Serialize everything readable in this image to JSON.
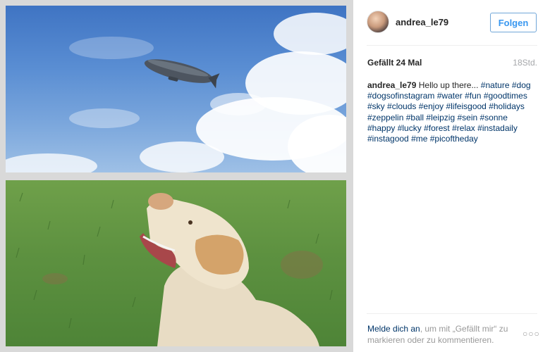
{
  "post": {
    "username": "andrea_le79",
    "follow_label": "Folgen",
    "likes": "Gefällt 24 Mal",
    "time": "18Std.",
    "caption_user": "andrea_le79",
    "caption_text": "Hello up there...",
    "hashtags": [
      "#nature",
      "#dog",
      "#dogsofinstagram",
      "#water",
      "#fun",
      "#goodtimes",
      "#sky",
      "#clouds",
      "#enjoy",
      "#lifeisgood",
      "#holidays",
      "#zeppelin",
      "#ball",
      "#leipzig",
      "#sein",
      "#sonne",
      "#happy",
      "#lucky",
      "#forest",
      "#relax",
      "#instadaily",
      "#instagood",
      "#me",
      "#picoftheday"
    ]
  },
  "login": {
    "link": "Melde dich an",
    "text": ", um mit „Gefällt mir“ zu markieren oder zu kommentieren."
  },
  "icons": {
    "more": "more-options-icon",
    "avatar": "profile-avatar"
  },
  "colors": {
    "follow_text": "#3897f0",
    "hashtag": "#003569",
    "muted": "#999999"
  }
}
